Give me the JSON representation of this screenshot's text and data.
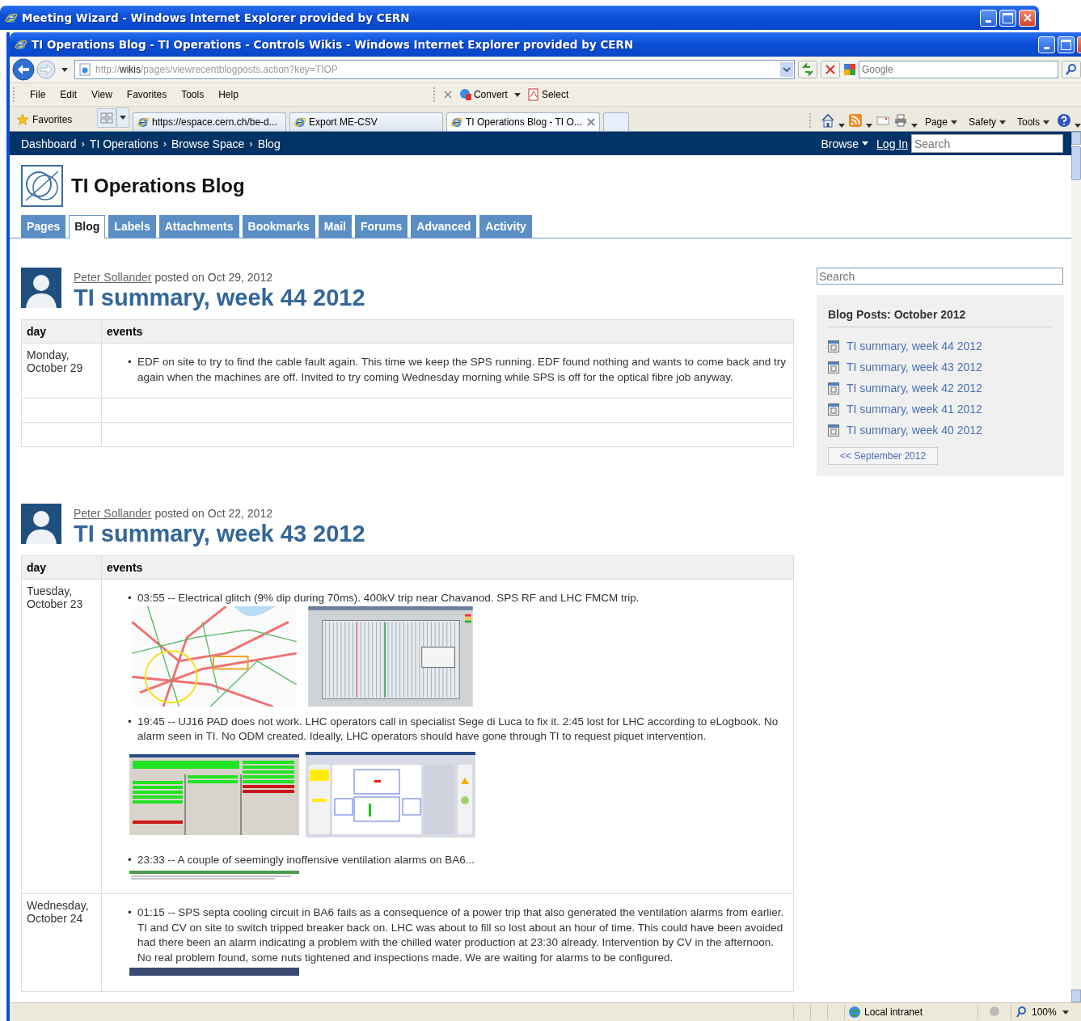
{
  "outer_window": {
    "title": "Meeting Wizard - Windows Internet Explorer provided by CERN"
  },
  "window": {
    "title": "TI Operations Blog - TI Operations - Controls Wikis - Windows Internet Explorer provided by CERN"
  },
  "address_bar": {
    "scheme": "http://",
    "host": "wikis",
    "path": "/pages/viewrecentblogposts.action?key=TIOP"
  },
  "web_search": {
    "placeholder": "Google"
  },
  "menu": [
    "File",
    "Edit",
    "View",
    "Favorites",
    "Tools",
    "Help"
  ],
  "toolbar": [
    "Convert",
    "Select"
  ],
  "favorites": "Favorites",
  "tabs": [
    {
      "label": "https://espace.cern.ch/be-d...",
      "selected": false
    },
    {
      "label": "Export ME-CSV",
      "selected": false
    },
    {
      "label": "TI Operations Blog - TI O...",
      "selected": true
    }
  ],
  "command_bar": [
    "Page",
    "Safety",
    "Tools"
  ],
  "breadcrumbs": [
    "Dashboard",
    "TI Operations",
    "Browse Space",
    "Blog"
  ],
  "breadcrumb_separators": [
    "›",
    "›",
    "›"
  ],
  "nav": {
    "browse": "Browse",
    "login": "Log In",
    "search_placeholder": "Search"
  },
  "space_title": "TI Operations Blog",
  "space_tabs": [
    {
      "label": "Pages",
      "selected": false
    },
    {
      "label": "Blog",
      "selected": true
    },
    {
      "label": "Labels",
      "selected": false
    },
    {
      "label": "Attachments",
      "selected": false
    },
    {
      "label": "Bookmarks",
      "selected": false
    },
    {
      "label": "Mail",
      "selected": false
    },
    {
      "label": "Forums",
      "selected": false
    },
    {
      "label": "Advanced",
      "selected": false
    },
    {
      "label": "Activity",
      "selected": false
    }
  ],
  "posts": [
    {
      "author": "Peter Sollander",
      "posted": "posted on Oct 29, 2012",
      "title": "TI summary, week 44 2012",
      "columns": [
        "day",
        "events"
      ],
      "rows": [
        {
          "day": "Monday, October 29",
          "events": [
            {
              "bullet": "•",
              "text": "EDF on site to try to find the cable fault again. This time we keep the SPS running.  EDF found nothing and wants to come back and try again when the machines are off. Invited to try coming Wednesday morning while SPS is off for the optical fibre job anyway."
            }
          ]
        },
        {},
        {}
      ]
    },
    {
      "author": "Peter Sollander",
      "posted": "posted on Oct 22, 2012",
      "title": "TI summary, week 43 2012",
      "columns": [
        "day",
        "events"
      ],
      "rows": [
        {
          "day": "Tuesday, October 23",
          "events": [
            {
              "bullet": "•",
              "text": "03:55 -- Electrical glitch (9% dip during 70ms). 400kV trip near Chavanod. SPS RF and LHC FMCM trip.",
              "images": [
                {
                  "kind": "map"
                },
                {
                  "kind": "waveform"
                }
              ]
            },
            {
              "bullet": "•",
              "text": "19:45 -- UJ16 PAD does not work.  LHC operators call in specialist Sege di Luca to fix it. 2:45 lost for LHC according to eLogbook.  No alarm seen in TI. No ODM created.  Ideally, LHC operators should have gone through TI to request piquet intervention.",
              "images": [
                {
                  "kind": "panel"
                },
                {
                  "kind": "synoptic"
                }
              ]
            },
            {
              "bullet": "•",
              "text": "23:33 -- A couple of seemingly inoffensive ventilation alarms on BA6...",
              "images": [
                {
                  "kind": "table"
                }
              ]
            }
          ]
        },
        {
          "day": "Wednesday, October 24",
          "events": [
            {
              "bullet": "•",
              "text": "01:15 -- SPS septa cooling circuit in BA6 fails as a consequence of a power trip that also generated the ventilation alarms from earlier.  TI and CV on site to switch tripped breaker back on. LHC was about to fill so lost about an hour of time.  This could have been avoided had there been an alarm indicating a problem with the chilled water production at 23:30 already.  Intervention by CV in the afternoon.  No real problem found, some nuts tightened and inspections made.  We are waiting for alarms to be configured.",
              "images": [
                {
                  "kind": "strip"
                }
              ]
            }
          ]
        }
      ]
    }
  ],
  "sidebar": {
    "search_placeholder": "Search",
    "heading": "Blog Posts: October 2012",
    "posts": [
      "TI summary, week 44 2012",
      "TI summary, week 43 2012",
      "TI summary, week 42 2012",
      "TI summary, week 41 2012",
      "TI summary, week 40 2012"
    ],
    "previous": "<< September 2012"
  },
  "status_bar": {
    "zone": "Local intranet",
    "zoom": "100%"
  }
}
